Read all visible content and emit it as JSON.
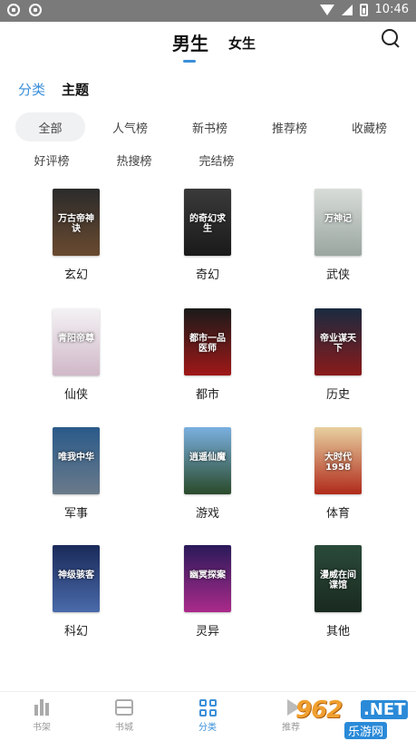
{
  "status": {
    "time": "10:46"
  },
  "header": {
    "tab_male": "男生",
    "tab_female": "女生"
  },
  "subtabs": {
    "category": "分类",
    "theme": "主题"
  },
  "filters": {
    "row1": [
      "全部",
      "人气榜",
      "新书榜",
      "推荐榜",
      "收藏榜"
    ],
    "row2": [
      "好评榜",
      "热搜榜",
      "完结榜"
    ],
    "active": "全部"
  },
  "categories": [
    {
      "label": "玄幻",
      "cover_text": "万古帝神诀",
      "color_top": "#2b2b2b",
      "color_bottom": "#6a4a30"
    },
    {
      "label": "奇幻",
      "cover_text": "的奇幻求生",
      "color_top": "#3a3a3a",
      "color_bottom": "#1a1a1a"
    },
    {
      "label": "武侠",
      "cover_text": "万神记",
      "color_top": "#d8dcd8",
      "color_bottom": "#9aa6a0"
    },
    {
      "label": "仙侠",
      "cover_text": "青阳帝尊",
      "color_top": "#f4f2f4",
      "color_bottom": "#d0b8c8"
    },
    {
      "label": "都市",
      "cover_text": "都市一品医师",
      "color_top": "#1a1a1a",
      "color_bottom": "#a01818"
    },
    {
      "label": "历史",
      "cover_text": "帝业谋天下",
      "color_top": "#1a2a40",
      "color_bottom": "#8a1a1a"
    },
    {
      "label": "军事",
      "cover_text": "唯我中华",
      "color_top": "#2a5a8a",
      "color_bottom": "#6a7a8a"
    },
    {
      "label": "游戏",
      "cover_text": "逍遥仙魔",
      "color_top": "#7ab0e0",
      "color_bottom": "#2a4a2a"
    },
    {
      "label": "体育",
      "cover_text": "大时代1958",
      "color_top": "#e8d0a0",
      "color_bottom": "#b02a1a"
    },
    {
      "label": "科幻",
      "cover_text": "神级骇客",
      "color_top": "#1a2a5a",
      "color_bottom": "#4a6aaa"
    },
    {
      "label": "灵异",
      "cover_text": "幽冥探案",
      "color_top": "#2a1a5a",
      "color_bottom": "#aa2a8a"
    },
    {
      "label": "其他",
      "cover_text": "漫威在间谍馆",
      "color_top": "#2a4a3a",
      "color_bottom": "#1a2a20"
    }
  ],
  "bottom_nav": {
    "items": [
      {
        "label": "书架",
        "icon": "bookshelf-icon"
      },
      {
        "label": "书城",
        "icon": "store-icon"
      },
      {
        "label": "分类",
        "icon": "category-icon"
      },
      {
        "label": "推荐",
        "icon": "recommend-icon"
      }
    ],
    "active": "分类"
  },
  "watermark": {
    "number": "962",
    "suffix": ".NET",
    "text": "乐游网"
  },
  "colors": {
    "accent": "#3b8fd9",
    "statusbar": "#7a7a7a"
  }
}
